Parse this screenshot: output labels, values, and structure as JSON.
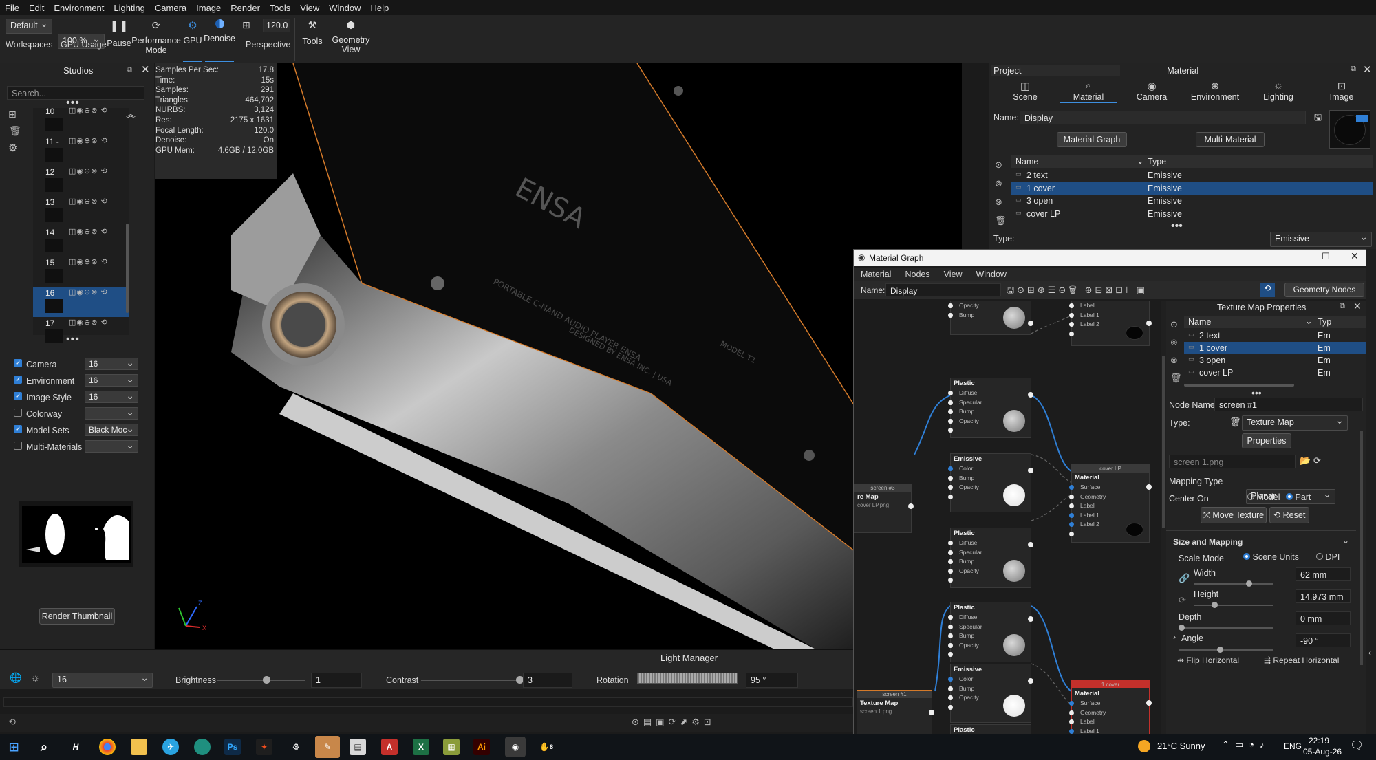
{
  "menubar": [
    "File",
    "Edit",
    "Environment",
    "Lighting",
    "Camera",
    "Image",
    "Render",
    "Tools",
    "View",
    "Window",
    "Help"
  ],
  "toolbar": {
    "workspace_value": "Default",
    "zoom_value": "100 %",
    "workspaces_label": "Workspaces",
    "gpu_usage_label": "GPU Usage",
    "pause_label": "Pause",
    "performance_label": "Performance Mode",
    "gpu_label": "GPU",
    "denoise_label": "Denoise",
    "fov_value": "120.0",
    "perspective_label": "Perspective",
    "tools_label": "Tools",
    "geometry_view_label": "Geometry View"
  },
  "studios": {
    "title": "Studios",
    "search_placeholder": "Search...",
    "items": [
      "10",
      "11 -",
      "12",
      "13",
      "14",
      "15",
      "16",
      "17"
    ],
    "selected": "16",
    "toggles": [
      {
        "label": "Camera",
        "checked": true,
        "value": "16"
      },
      {
        "label": "Environment",
        "checked": true,
        "value": "16"
      },
      {
        "label": "Image Style",
        "checked": true,
        "value": "16"
      },
      {
        "label": "Colorway",
        "checked": false,
        "value": ""
      },
      {
        "label": "Model Sets",
        "checked": true,
        "value": "Black Moc"
      },
      {
        "label": "Multi-Materials",
        "checked": false,
        "value": ""
      }
    ],
    "render_thumbnail": "Render Thumbnail"
  },
  "stats": [
    {
      "k": "Samples Per Sec:",
      "v": "17.8"
    },
    {
      "k": "Time:",
      "v": "15s"
    },
    {
      "k": "Samples:",
      "v": "291"
    },
    {
      "k": "Triangles:",
      "v": "464,702"
    },
    {
      "k": "NURBS:",
      "v": "3,124"
    },
    {
      "k": "Res:",
      "v": "2175 x 1631"
    },
    {
      "k": "Focal Length:",
      "v": "120.0"
    },
    {
      "k": "Denoise:",
      "v": "On"
    },
    {
      "k": "GPU Mem:",
      "v": "4.6GB / 12.0GB"
    }
  ],
  "viewport": {
    "product_text_1": "PORTABLE C-NAND AUDIO PLAYER ENSA",
    "product_text_2": "DESIGNED BY ENSA INC. | USA",
    "product_text_3": "MODEL T1",
    "logo": "ENSA"
  },
  "light_manager": {
    "title": "Light Manager",
    "environment_value": "16",
    "brightness_label": "Brightness",
    "brightness_value": "1",
    "contrast_label": "Contrast",
    "contrast_value": "3",
    "rotation_label": "Rotation",
    "rotation_value": "95 °"
  },
  "project": {
    "left_title": "Project",
    "title": "Material",
    "tabs": [
      "Scene",
      "Material",
      "Camera",
      "Environment",
      "Lighting",
      "Image"
    ],
    "active_tab": "Material",
    "name_label": "Name:",
    "name_value": "Display",
    "material_graph_button": "Material Graph",
    "multi_material_button": "Multi-Material",
    "col_name": "Name",
    "col_type": "Type",
    "rows": [
      {
        "name": "2 text",
        "type": "Emissive"
      },
      {
        "name": "1 cover",
        "type": "Emissive"
      },
      {
        "name": "3 open",
        "type": "Emissive"
      },
      {
        "name": "cover LP",
        "type": "Emissive"
      }
    ],
    "type_label": "Type:",
    "type_value": "Emissive"
  },
  "material_graph": {
    "title": "Material Graph",
    "menu": [
      "Material",
      "Nodes",
      "View",
      "Window"
    ],
    "name_label": "Name:",
    "name_value": "Display",
    "geometry_nodes_button": "Geometry Nodes",
    "nodes": {
      "opacity": "Opacity",
      "plastic": "Plastic",
      "emissive": "Emissive",
      "material": "Material",
      "label1": "Label 1",
      "label2": "Label 2",
      "label": "Label",
      "diffuse": "Diffuse",
      "specular": "Specular",
      "bump": "Bump",
      "color": "Color",
      "surface": "Surface",
      "geometry": "Geometry",
      "cover_lp": "cover LP",
      "one_cover": "1 cover",
      "screen3": "screen #3",
      "screen1": "screen #1",
      "texture_map": "Texture Map",
      "re_map": "re Map",
      "cover_lp_png": "cover LP.png",
      "screen_png": "screen 1.png"
    }
  },
  "texture_props": {
    "title": "Texture Map Properties",
    "col_name": "Name",
    "col_type": "Typ",
    "rows": [
      {
        "name": "2 text",
        "type": "Em"
      },
      {
        "name": "1 cover",
        "type": "Em"
      },
      {
        "name": "3 open",
        "type": "Em"
      },
      {
        "name": "cover LP",
        "type": "Em"
      }
    ],
    "node_name_label": "Node Name:",
    "node_name_value": "screen #1",
    "type_label": "Type:",
    "type_value": "Texture Map",
    "properties_button": "Properties",
    "file_value": "screen 1.png",
    "mapping_type_label": "Mapping Type",
    "mapping_type_value": "Planar",
    "center_on_label": "Center On",
    "center_model": "Model",
    "center_part": "Part",
    "move_texture": "Move Texture",
    "reset": "Reset",
    "section": "Size and Mapping",
    "scale_mode_label": "Scale Mode",
    "scene_units": "Scene Units",
    "dpi": "DPI",
    "width_label": "Width",
    "width_value": "62 mm",
    "height_label": "Height",
    "height_value": "14.973 mm",
    "depth_label": "Depth",
    "depth_value": "0 mm",
    "angle_label": "Angle",
    "angle_value": "-90 °",
    "flip_horizontal": "Flip Horizontal",
    "repeat_horizontal": "Repeat Horizontal"
  },
  "taskbar": {
    "weather": "21°C  Sunny",
    "lang": "ENG",
    "time": "22:19",
    "date": "05-Aug-26",
    "badge": "8"
  },
  "colors": {
    "accent": "#2f7fd6",
    "selection": "#1f4e85",
    "highlight_orange": "#d47a2a",
    "node_red": "#c4302b"
  }
}
